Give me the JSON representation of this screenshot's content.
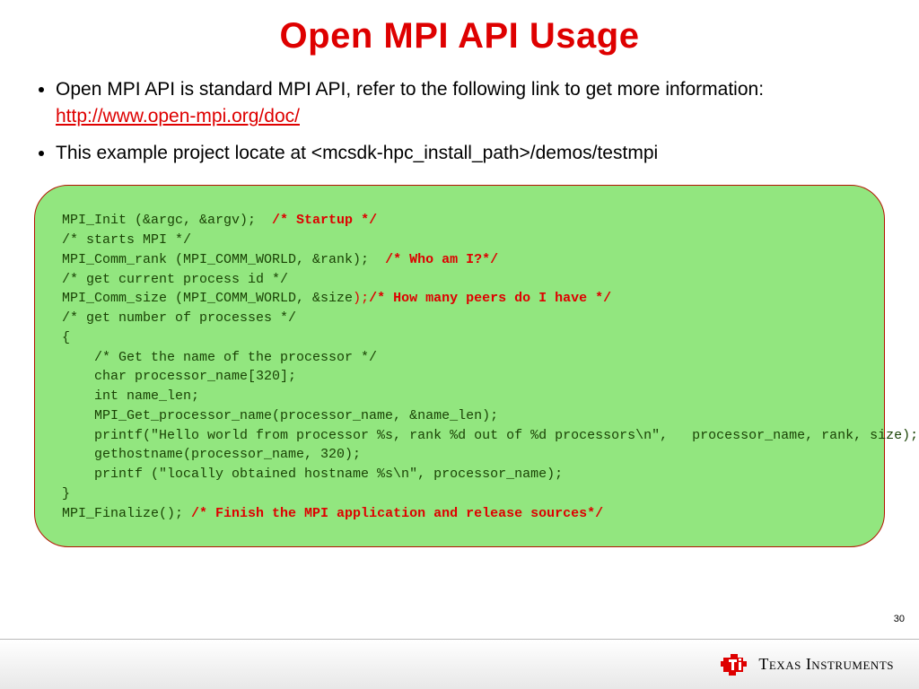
{
  "title": "Open MPI API Usage",
  "bullets": {
    "b1_prefix": "Open MPI API is standard MPI API, refer to the following link to get more information: ",
    "b1_link_text": "http://www.open-mpi.org/doc/",
    "b1_link_href": "http://www.open-mpi.org/doc/",
    "b2": "This example project locate at <mcsdk-hpc_install_path>/demos/testmpi"
  },
  "code": {
    "l1a": "MPI_Init (&argc, &argv);  ",
    "l1b": "/* Startup */",
    "l2": "/* starts MPI */",
    "l3a": "MPI_Comm_rank (MPI_COMM_WORLD, &rank);  ",
    "l3b": "/* Who am I?*/",
    "l4": "/* get current process id */",
    "l5a": "MPI_Comm_size (MPI_COMM_WORLD, &size",
    "l5b": ");",
    "l5c": "/* How many peers do I have */",
    "l6": "/* get number of processes */",
    "l7": "{",
    "l8": "    /* Get the name of the processor */",
    "l9": "    char processor_name[320];",
    "l10": "    int name_len;",
    "l11": "    MPI_Get_processor_name(processor_name, &name_len);",
    "l12": "    printf(\"Hello world from processor %s, rank %d out of %d processors\\n\",   processor_name, rank, size);",
    "l13": "    gethostname(processor_name, 320);",
    "l14": "    printf (\"locally obtained hostname %s\\n\", processor_name);",
    "l15": "}",
    "l16a": "MPI_Finalize(); ",
    "l16b": "/* Finish the MPI application and release sources*/"
  },
  "page_number": "30",
  "footer": {
    "brand": "Texas Instruments"
  }
}
